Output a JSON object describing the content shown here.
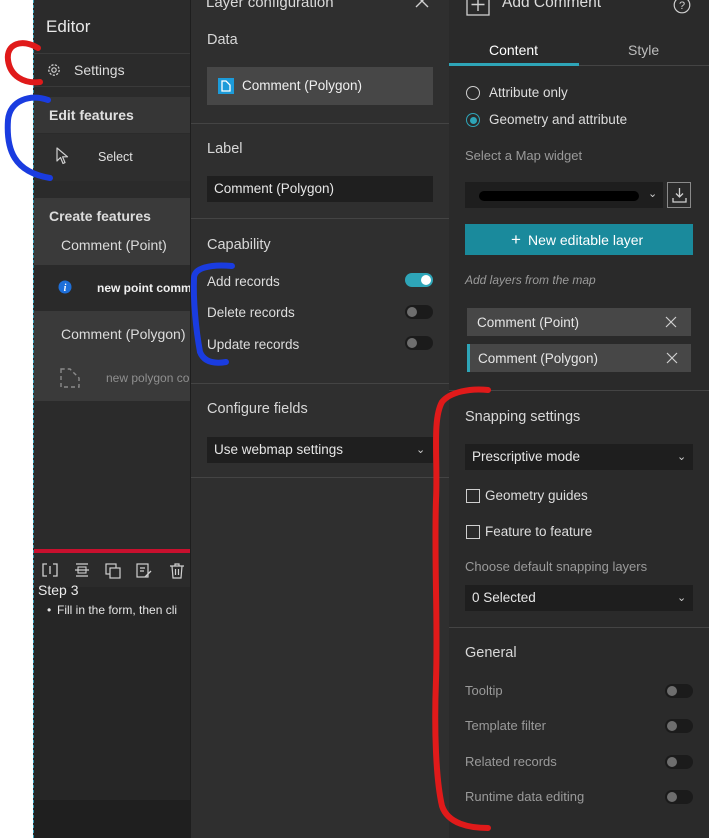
{
  "left_panel": {
    "title": "Editor",
    "settings_label": "Settings",
    "edit_features_label": "Edit features",
    "select_label": "Select",
    "create_features_label": "Create features",
    "point_group_label": "Comment (Point)",
    "point_item_label": "new point comm",
    "polygon_group_label": "Comment (Polygon)",
    "polygon_item_label": "new polygon co",
    "step_title": "Step 3",
    "step_bullet": "Fill in the form, then cli"
  },
  "middle_panel": {
    "title": "Layer configuration",
    "data_label": "Data",
    "data_layer": "Comment (Polygon)",
    "label_label": "Label",
    "label_value": "Comment (Polygon)",
    "capability_label": "Capability",
    "capabilities": [
      {
        "label": "Add records",
        "on": true
      },
      {
        "label": "Delete records",
        "on": false
      },
      {
        "label": "Update records",
        "on": false
      }
    ],
    "configure_fields_label": "Configure fields",
    "configure_fields_value": "Use webmap settings"
  },
  "right_panel": {
    "title": "Add Comment",
    "tabs": [
      "Content",
      "Style"
    ],
    "active_tab": "Content",
    "radio_options": [
      "Attribute only",
      "Geometry and attribute"
    ],
    "selected_radio": "Geometry and attribute",
    "map_widget_label": "Select a Map widget",
    "new_layer_button": "New editable layer",
    "add_layers_hint": "Add layers from the map",
    "layers": [
      "Comment (Point)",
      "Comment (Polygon)"
    ],
    "snapping_label": "Snapping settings",
    "snapping_mode": "Prescriptive mode",
    "geometry_guides_label": "Geometry guides",
    "feature_to_feature_label": "Feature to feature",
    "default_snapping_label": "Choose default snapping layers",
    "default_snapping_value": "0 Selected",
    "general_label": "General",
    "general_toggles": [
      "Tooltip",
      "Template filter",
      "Related records",
      "Runtime data editing"
    ]
  },
  "colors": {
    "accent": "#2ea5b8",
    "button": "#1a8a9c",
    "annotation_red": "#e01a1a",
    "annotation_blue": "#1a3ce0"
  }
}
